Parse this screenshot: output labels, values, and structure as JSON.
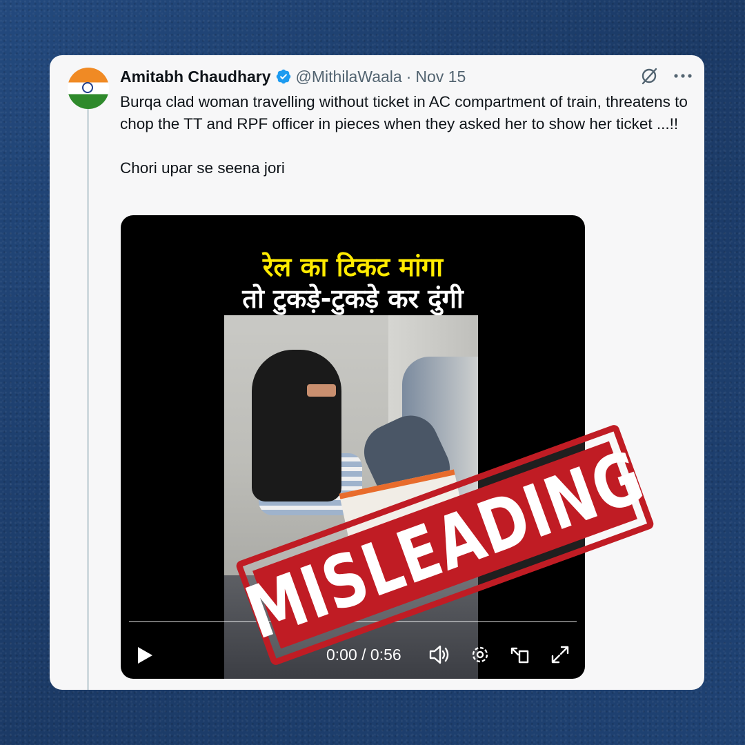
{
  "post": {
    "author_name": "Amitabh Chaudhary",
    "handle": "@MithilaWaala",
    "separator": "·",
    "date": "Nov 15",
    "text_line1": "Burqa clad woman travelling without ticket in AC compartment of train, threatens to chop the TT and RPF officer in pieces when they asked her to show her ticket ...!!",
    "text_line2": "Chori upar se seena jori",
    "icons": [
      "verified-badge-icon",
      "grok-icon",
      "more-icon"
    ]
  },
  "video": {
    "caption_line1": "रेल का टिकट मांगा",
    "caption_line2": "तो टुकड़े-टुकड़े कर दुंगी",
    "time": "0:00 / 0:56",
    "progress": 0,
    "icons": [
      "play-icon",
      "volume-icon",
      "settings-icon",
      "pip-icon",
      "fullscreen-icon"
    ]
  },
  "stamp": {
    "label": "MISLEADING",
    "color": "#c01c24"
  },
  "colors": {
    "background": "#1d3f6e",
    "card": "#f7f7f8",
    "verified": "#1d9bf0",
    "caption_yellow": "#ffeb00"
  }
}
